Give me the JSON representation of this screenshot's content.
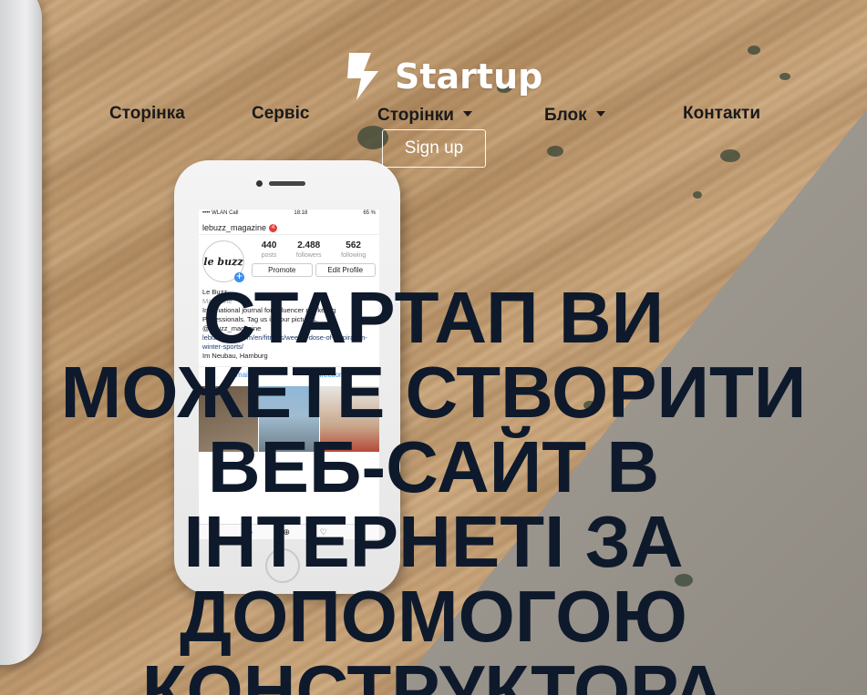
{
  "brand": {
    "name": "Startup",
    "icon": "lightning-bolt-icon"
  },
  "nav": {
    "items": [
      {
        "label": "Сторінка",
        "dropdown": false
      },
      {
        "label": "Сервіс",
        "dropdown": false
      },
      {
        "label": "Сторінки",
        "dropdown": true
      },
      {
        "label": "Блок",
        "dropdown": true
      },
      {
        "label": "Контакти",
        "dropdown": false
      }
    ],
    "signup_label": "Sign up"
  },
  "hero": {
    "title": "Стартап Ви можете створити веб-сайт в Інтернеті за допомогою конструктора"
  },
  "phone": {
    "status": {
      "carrier": "•••• WLAN Call",
      "time": "18:18",
      "battery": "65 %"
    },
    "username": "lebuzz_magazine",
    "notifications": "4",
    "avatar_text": "le buzz",
    "stats": [
      {
        "value": "440",
        "label": "posts"
      },
      {
        "value": "2.488",
        "label": "followers"
      },
      {
        "value": "562",
        "label": "following"
      }
    ],
    "promote_label": "Promote",
    "edit_label": "Edit Profile",
    "bio_name": "Le Buzz",
    "bio_category": "Magazine",
    "bio_text": "International journal for influencer marketing Professionals. Tag us in your pictures, @ebuzz_magazine",
    "bio_link": "lebuzz-mag.com/en/fitness/weekly-dose-of-inspiration-winter-sports/",
    "bio_location": "Im Neubau, Hamburg",
    "actions": [
      "Email",
      "Directions"
    ]
  },
  "colors": {
    "hero_text": "#0e1a2b",
    "nav_text": "#1a1a1a",
    "logo": "#ffffff"
  }
}
